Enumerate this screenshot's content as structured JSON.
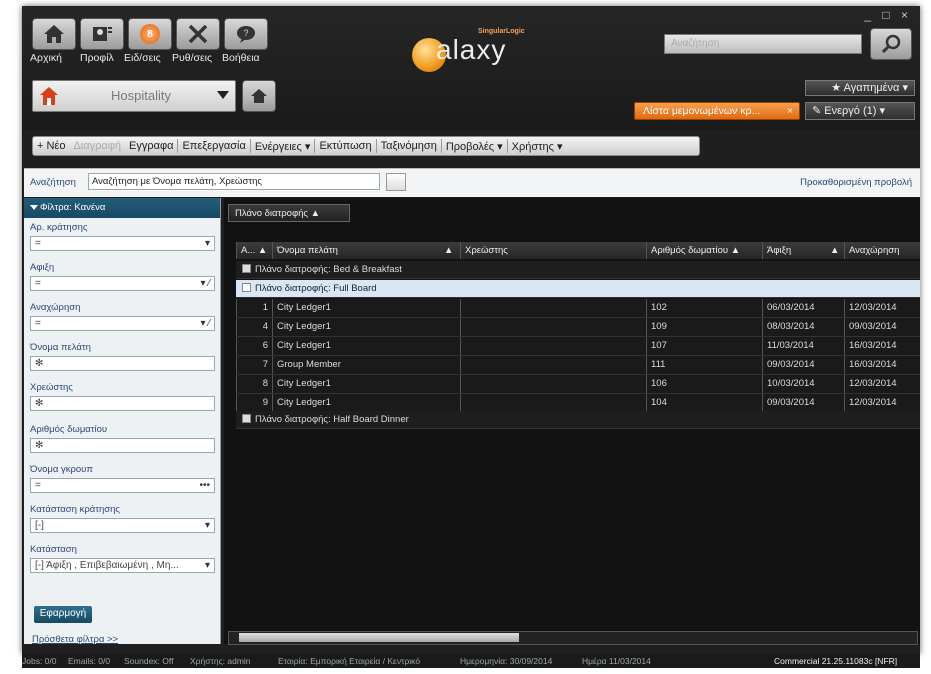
{
  "window": {
    "controls": "_ □ ×"
  },
  "topnav": {
    "items": [
      {
        "label": "Αρχική",
        "icon": "home-icon"
      },
      {
        "label": "Προφίλ",
        "icon": "profile-icon"
      },
      {
        "label": "Ειδ/σεις",
        "icon": "notifications-icon",
        "badge": "8"
      },
      {
        "label": "Ρυθ/σεις",
        "icon": "tools-icon"
      },
      {
        "label": "Βοήθεια",
        "icon": "help-icon"
      }
    ],
    "module": "Hospitality"
  },
  "logo": {
    "brand": "SingularLogic",
    "name": "alaxy"
  },
  "search": {
    "placeholder": "Αναζήτηση"
  },
  "favorites": "★ Αγαπημένα ▾",
  "recent_tab": {
    "label": "Λίστα μεμονωμένων κρ...",
    "close": "×"
  },
  "active": "Ενεργό (1) ▾",
  "toolbar": {
    "new": "+ Νέο",
    "delete": "Διαγραφή",
    "records": "Εγγραφα",
    "edit": "Επεξεργασία",
    "actions": "Ενέργειες ▾",
    "print": "Εκτύπωση",
    "sort": "Ταξινόμηση",
    "views": "Προβολές ▾",
    "user": "Χρήστης ▾"
  },
  "searchrow": {
    "label": "Αναζήτηση",
    "value": "Αναζήτηση με Όνομα πελάτη, Χρεώστης",
    "default_view": "Προκαθορισμένη προβολή"
  },
  "filter": {
    "header": "Φίλτρα: Κανένα",
    "fields": [
      {
        "label": "Αρ. κράτησης",
        "value": "=",
        "arrow": "▾"
      },
      {
        "label": "Αφιξη",
        "value": "=",
        "arrow": "▾ ⁄"
      },
      {
        "label": "Αναχώρηση",
        "value": "=",
        "arrow": "▾ ⁄"
      },
      {
        "label": "Όνομα πελάτη",
        "value": "✻",
        "arrow": ""
      },
      {
        "label": "Χρεώστης",
        "value": "✻",
        "arrow": ""
      },
      {
        "label": "Αριθμός δωματίου",
        "value": "✻",
        "arrow": ""
      },
      {
        "label": "Όνομα γκρουπ",
        "value": "=",
        "arrow": "•••"
      },
      {
        "label": "Κατάσταση κράτησης",
        "value": "[-]",
        "arrow": "▾"
      },
      {
        "label": "Κατάσταση",
        "value": "[-]  Άφιξη , Επιβεβαιωμένη , Μη...",
        "arrow": "▾"
      }
    ],
    "apply": "Εφαρμογή",
    "more": "Πρόσθετα φίλτρα >>"
  },
  "grid": {
    "group_button": "Πλάνο διατροφής  ▲",
    "columns": [
      "A... ▲",
      "Όνομα πελάτη",
      "▲",
      "Χρεώστης",
      "Αριθμός δωματίου  ▲",
      "Άφιξη",
      "▲",
      "Αναχώρηση"
    ],
    "groups": [
      {
        "label": "Πλάνο διατροφής: Bed & Breakfast",
        "expanded": false
      },
      {
        "label": "Πλάνο διατροφής: Full Board",
        "expanded": true
      },
      {
        "label": "Πλάνο διατροφής: Half Board Dinner",
        "expanded": false
      }
    ],
    "rows": [
      {
        "a": "1",
        "name": "City Ledger1",
        "debtor": "",
        "room": "102",
        "arrival": "06/03/2014",
        "departure": "12/03/2014"
      },
      {
        "a": "4",
        "name": "City Ledger1",
        "debtor": "",
        "room": "109",
        "arrival": "08/03/2014",
        "departure": "09/03/2014"
      },
      {
        "a": "6",
        "name": "City Ledger1",
        "debtor": "",
        "room": "107",
        "arrival": "11/03/2014",
        "departure": "16/03/2014"
      },
      {
        "a": "7",
        "name": "Group Member",
        "debtor": "",
        "room": "111",
        "arrival": "09/03/2014",
        "departure": "16/03/2014"
      },
      {
        "a": "8",
        "name": "City Ledger1",
        "debtor": "",
        "room": "106",
        "arrival": "10/03/2014",
        "departure": "12/03/2014"
      },
      {
        "a": "9",
        "name": "City Ledger1",
        "debtor": "",
        "room": "104",
        "arrival": "09/03/2014",
        "departure": "12/03/2014"
      }
    ]
  },
  "statusbar": {
    "jobs": "Jobs: 0/0",
    "emails": "Emails: 0/0",
    "soundex": "Soundex: Off",
    "user": "Χρήστης: admin",
    "company": "Εταιρία: Εμπορική Εταιρεία / Κεντρικό",
    "ledger_date": "Ημερομηνία: 30/09/2014",
    "day": "Ημέρα 11/03/2014",
    "version": "Commercial  21.25.11083c [NFR]"
  }
}
